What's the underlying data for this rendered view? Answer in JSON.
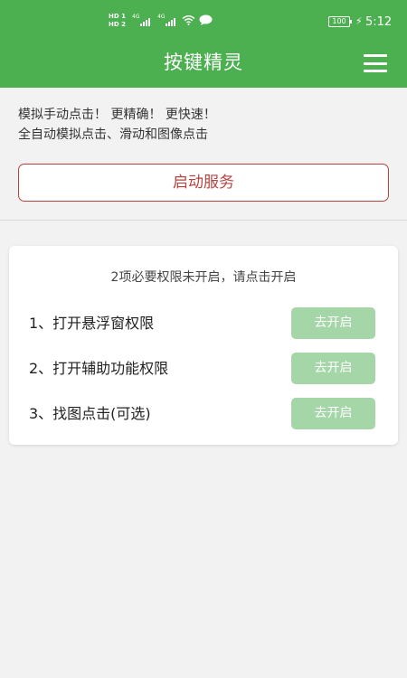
{
  "status_bar": {
    "hd1": "HD 1",
    "hd2": "HD 2",
    "sig1_tag": "4G",
    "sig2_tag": "4G",
    "battery": "100",
    "time": "5:12"
  },
  "header": {
    "title": "按键精灵",
    "menu_icon": "hamburger-menu-icon",
    "bg_color": "#4caf50"
  },
  "intro": {
    "line1": "模拟手动点击！ 更精确！ 更快速！",
    "line2": "全自动模拟点击、滑动和图像点击"
  },
  "start_button": {
    "label": "启动服务",
    "color": "#b5443f"
  },
  "permissions": {
    "notice": "2项必要权限未开启，请点击开启",
    "button_color": "#a5d6a7",
    "items": [
      {
        "label": "1、打开悬浮窗权限",
        "button": "去开启"
      },
      {
        "label": "2、打开辅助功能权限",
        "button": "去开启"
      },
      {
        "label": "3、找图点击(可选)",
        "button": "去开启"
      }
    ]
  }
}
